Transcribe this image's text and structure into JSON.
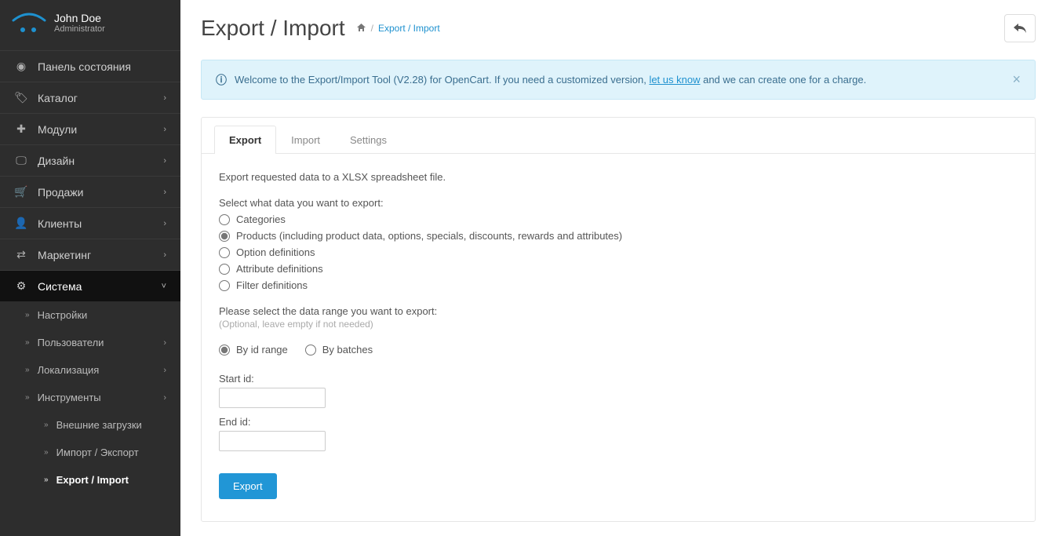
{
  "user": {
    "name": "John Doe",
    "role": "Administrator"
  },
  "sidebar": {
    "items": [
      {
        "icon": "dashboard",
        "label": "Панель состояния",
        "expandable": false
      },
      {
        "icon": "tag",
        "label": "Каталог",
        "expandable": true
      },
      {
        "icon": "puzzle",
        "label": "Модули",
        "expandable": true
      },
      {
        "icon": "monitor",
        "label": "Дизайн",
        "expandable": true
      },
      {
        "icon": "cart",
        "label": "Продажи",
        "expandable": true
      },
      {
        "icon": "user",
        "label": "Клиенты",
        "expandable": true
      },
      {
        "icon": "share",
        "label": "Маркетинг",
        "expandable": true
      },
      {
        "icon": "gear",
        "label": "Система",
        "expandable": true,
        "open": true
      }
    ],
    "system_sub": [
      {
        "label": "Настройки"
      },
      {
        "label": "Пользователи",
        "expandable": true
      },
      {
        "label": "Локализация",
        "expandable": true
      },
      {
        "label": "Инструменты",
        "expandable": true,
        "open": true
      }
    ],
    "tools_sub": [
      {
        "label": "Внешние загрузки"
      },
      {
        "label": "Импорт / Экспорт"
      },
      {
        "label": "Export / Import",
        "current": true
      }
    ]
  },
  "header": {
    "title": "Export / Import",
    "breadcrumb_sep": "/",
    "breadcrumb_current": "Export / Import"
  },
  "alert": {
    "prefix": "Welcome to the Export/Import Tool (V2.28) for OpenCart. If you need a customized version, ",
    "link": "let us know",
    "suffix": " and we can create one for a charge."
  },
  "tabs": [
    {
      "label": "Export",
      "active": true
    },
    {
      "label": "Import"
    },
    {
      "label": "Settings"
    }
  ],
  "export": {
    "intro": "Export requested data to a XLSX spreadsheet file.",
    "select_label": "Select what data you want to export:",
    "options": [
      {
        "label": "Categories",
        "checked": false
      },
      {
        "label": "Products (including product data, options, specials, discounts, rewards and attributes)",
        "checked": true
      },
      {
        "label": "Option definitions",
        "checked": false
      },
      {
        "label": "Attribute definitions",
        "checked": false
      },
      {
        "label": "Filter definitions",
        "checked": false
      }
    ],
    "range_label": "Please select the data range you want to export:",
    "range_help": "(Optional, leave empty if not needed)",
    "range_modes": [
      {
        "label": "By id range",
        "checked": true
      },
      {
        "label": "By batches",
        "checked": false
      }
    ],
    "start_label": "Start id:",
    "end_label": "End id:",
    "button": "Export"
  },
  "icons": {
    "dashboard": "◉",
    "tag": "🏷",
    "puzzle": "✚",
    "monitor": "🖵",
    "cart": "🛒",
    "user": "👤",
    "share": "⇄",
    "gear": "⚙"
  }
}
